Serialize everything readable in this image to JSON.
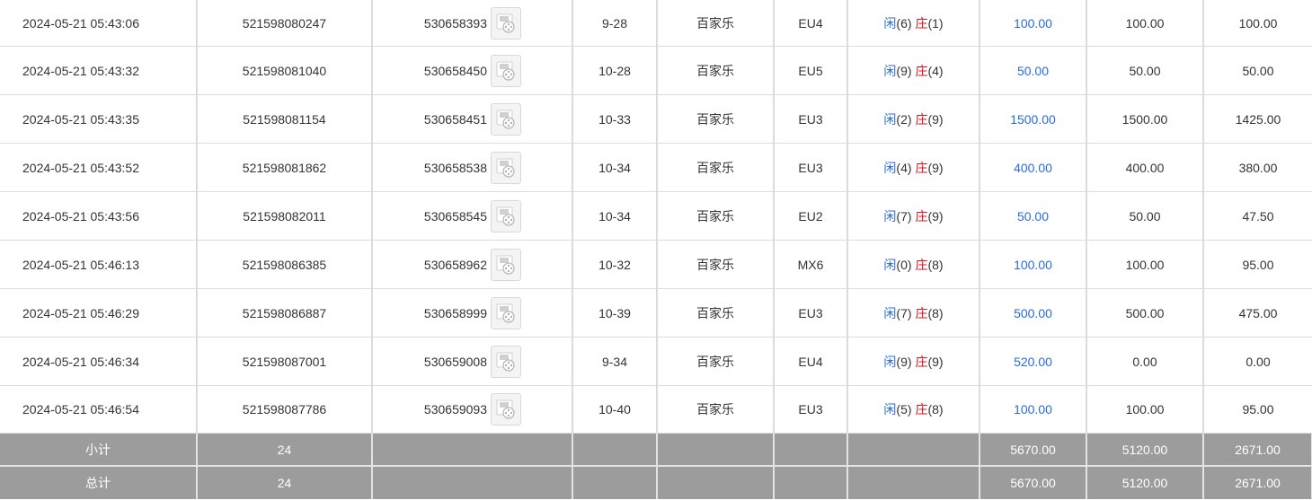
{
  "rows": [
    {
      "time": "2024-05-21 05:43:06",
      "bet_id": "521598080247",
      "game_id": "530658393",
      "shoe": "9-28",
      "game_type": "百家乐",
      "table": "EU4",
      "player_label": "闲",
      "player_score": "(6)",
      "banker_label": "庄",
      "banker_score": "(1)",
      "bet_amount": "100.00",
      "valid_amount": "100.00",
      "payout": "100.00"
    },
    {
      "time": "2024-05-21 05:43:32",
      "bet_id": "521598081040",
      "game_id": "530658450",
      "shoe": "10-28",
      "game_type": "百家乐",
      "table": "EU5",
      "player_label": "闲",
      "player_score": "(9)",
      "banker_label": "庄",
      "banker_score": "(4)",
      "bet_amount": "50.00",
      "valid_amount": "50.00",
      "payout": "50.00"
    },
    {
      "time": "2024-05-21 05:43:35",
      "bet_id": "521598081154",
      "game_id": "530658451",
      "shoe": "10-33",
      "game_type": "百家乐",
      "table": "EU3",
      "player_label": "闲",
      "player_score": "(2)",
      "banker_label": "庄",
      "banker_score": "(9)",
      "bet_amount": "1500.00",
      "valid_amount": "1500.00",
      "payout": "1425.00"
    },
    {
      "time": "2024-05-21 05:43:52",
      "bet_id": "521598081862",
      "game_id": "530658538",
      "shoe": "10-34",
      "game_type": "百家乐",
      "table": "EU3",
      "player_label": "闲",
      "player_score": "(4)",
      "banker_label": "庄",
      "banker_score": "(9)",
      "bet_amount": "400.00",
      "valid_amount": "400.00",
      "payout": "380.00"
    },
    {
      "time": "2024-05-21 05:43:56",
      "bet_id": "521598082011",
      "game_id": "530658545",
      "shoe": "10-34",
      "game_type": "百家乐",
      "table": "EU2",
      "player_label": "闲",
      "player_score": "(7)",
      "banker_label": "庄",
      "banker_score": "(9)",
      "bet_amount": "50.00",
      "valid_amount": "50.00",
      "payout": "47.50"
    },
    {
      "time": "2024-05-21 05:46:13",
      "bet_id": "521598086385",
      "game_id": "530658962",
      "shoe": "10-32",
      "game_type": "百家乐",
      "table": "MX6",
      "player_label": "闲",
      "player_score": "(0)",
      "banker_label": "庄",
      "banker_score": "(8)",
      "bet_amount": "100.00",
      "valid_amount": "100.00",
      "payout": "95.00"
    },
    {
      "time": "2024-05-21 05:46:29",
      "bet_id": "521598086887",
      "game_id": "530658999",
      "shoe": "10-39",
      "game_type": "百家乐",
      "table": "EU3",
      "player_label": "闲",
      "player_score": "(7)",
      "banker_label": "庄",
      "banker_score": "(8)",
      "bet_amount": "500.00",
      "valid_amount": "500.00",
      "payout": "475.00"
    },
    {
      "time": "2024-05-21 05:46:34",
      "bet_id": "521598087001",
      "game_id": "530659008",
      "shoe": "9-34",
      "game_type": "百家乐",
      "table": "EU4",
      "player_label": "闲",
      "player_score": "(9)",
      "banker_label": "庄",
      "banker_score": "(9)",
      "bet_amount": "520.00",
      "valid_amount": "0.00",
      "payout": "0.00"
    },
    {
      "time": "2024-05-21 05:46:54",
      "bet_id": "521598087786",
      "game_id": "530659093",
      "shoe": "10-40",
      "game_type": "百家乐",
      "table": "EU3",
      "player_label": "闲",
      "player_score": "(5)",
      "banker_label": "庄",
      "banker_score": "(8)",
      "bet_amount": "100.00",
      "valid_amount": "100.00",
      "payout": "95.00"
    }
  ],
  "subtotal": {
    "label": "小计",
    "count": "24",
    "bet_amount": "5670.00",
    "valid_amount": "5120.00",
    "payout": "2671.00"
  },
  "total": {
    "label": "总计",
    "count": "24",
    "bet_amount": "5670.00",
    "valid_amount": "5120.00",
    "payout": "2671.00"
  },
  "icons": {
    "replay": "video-camera-icon"
  },
  "colors": {
    "player": "#2a6ae0",
    "banker": "#d9141e",
    "bet_amount": "#2a6ae0",
    "summary_bg": "#9c9c9c"
  }
}
